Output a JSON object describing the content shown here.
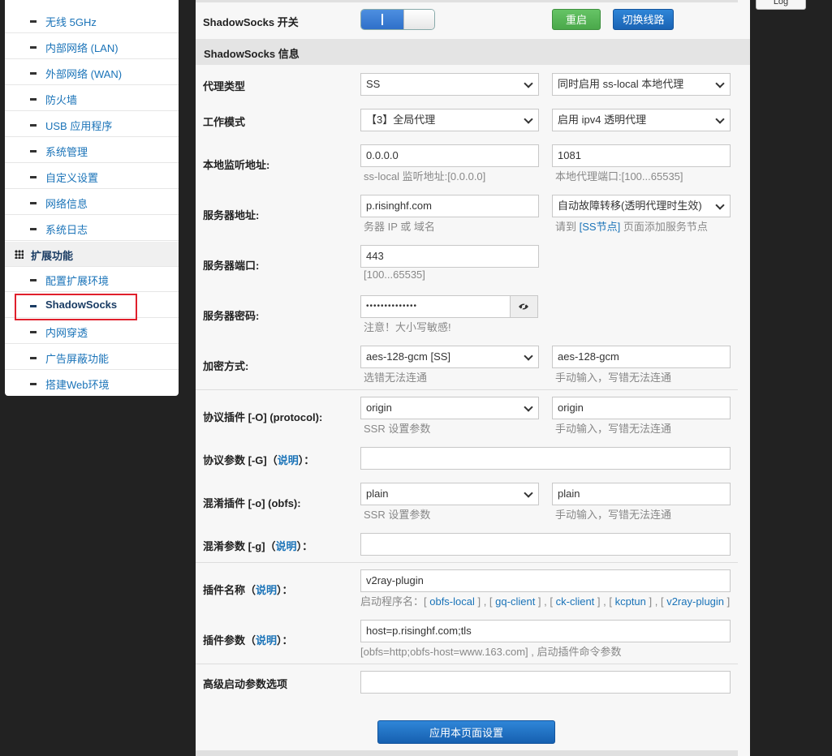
{
  "sidebar": {
    "items_top": [
      {
        "label": "无线 5GHz"
      },
      {
        "label": "内部网络 (LAN)"
      },
      {
        "label": "外部网络 (WAN)"
      },
      {
        "label": "防火墙"
      },
      {
        "label": "USB 应用程序"
      },
      {
        "label": "系统管理"
      },
      {
        "label": "自定义设置"
      },
      {
        "label": "网络信息"
      },
      {
        "label": "系统日志"
      }
    ],
    "section_label": "扩展功能",
    "items_ext": [
      {
        "label": "配置扩展环境"
      },
      {
        "label": "ShadowSocks"
      },
      {
        "label": "内网穿透"
      },
      {
        "label": "广告屏蔽功能"
      },
      {
        "label": "搭建Web环境"
      }
    ]
  },
  "header": {
    "log_label": "Log"
  },
  "main": {
    "switch_label": "ShadowSocks 开关",
    "restart_label": "重启",
    "switch_route_label": "切换线路",
    "info_header": "ShadowSocks 信息",
    "proxy_type": {
      "label": "代理类型",
      "value1": "SS",
      "value2": "同时启用 ss-local 本地代理"
    },
    "work_mode": {
      "label": "工作模式",
      "value1": "【3】全局代理",
      "value2": "启用 ipv4 透明代理"
    },
    "local_listen": {
      "label": "本地监听地址:",
      "value1": "0.0.0.0",
      "hint1": "ss-local 监听地址:[0.0.0.0]",
      "value2": "1081",
      "hint2": "本地代理端口:[100...65535]"
    },
    "server_addr": {
      "label": "服务器地址:",
      "value1": "p.risinghf.com",
      "hint1": "务器 IP 或 域名",
      "value2": "自动故障转移(透明代理时生效)",
      "hint2_pre": "请到 ",
      "hint2_link": "[SS节点]",
      "hint2_post": " 页面添加服务节点"
    },
    "server_port": {
      "label": "服务器端口:",
      "value": "443",
      "hint": "[100...65535]"
    },
    "server_pw": {
      "label": "服务器密码:",
      "value": "••••••••••••••",
      "hint": "注意！大小写敏感!"
    },
    "encrypt": {
      "label": "加密方式:",
      "value1": "aes-128-gcm [SS]",
      "hint1": "选错无法连通",
      "value2": "aes-128-gcm",
      "hint2": "手动输入，写错无法连通"
    },
    "protocol": {
      "label": "协议插件 [-O] (protocol):",
      "value1": "origin",
      "hint1": "SSR 设置参数",
      "value2": "origin",
      "hint2": "手动输入，写错无法连通"
    },
    "protocol_param": {
      "label_pre": "协议参数 [-G]（",
      "label_link": "说明",
      "label_post": "）："
    },
    "obfs": {
      "label": "混淆插件 [-o] (obfs):",
      "value1": "plain",
      "hint1": "SSR 设置参数",
      "value2": "plain",
      "hint2": "手动输入，写错无法连通"
    },
    "obfs_param": {
      "label_pre": "混淆参数 [-g]（",
      "label_link": "说明",
      "label_post": "）："
    },
    "plugin_name": {
      "label_pre": "插件名称（",
      "label_link": "说明",
      "label_post": "）：",
      "value": "v2ray-plugin",
      "hint_pre": "启动程序名：[ ",
      "links": [
        "obfs-local",
        "gq-client",
        "ck-client",
        "kcptun",
        "v2ray-plugin"
      ]
    },
    "plugin_param": {
      "label_pre": "插件参数（",
      "label_link": "说明",
      "label_post": "）：",
      "value": "host=p.risinghf.com;tls",
      "hint": "[obfs=http;obfs-host=www.163.com] , 启动插件命令参数"
    },
    "advanced": {
      "label": "高级启动参数选项"
    },
    "apply_label": "应用本页面设置"
  }
}
